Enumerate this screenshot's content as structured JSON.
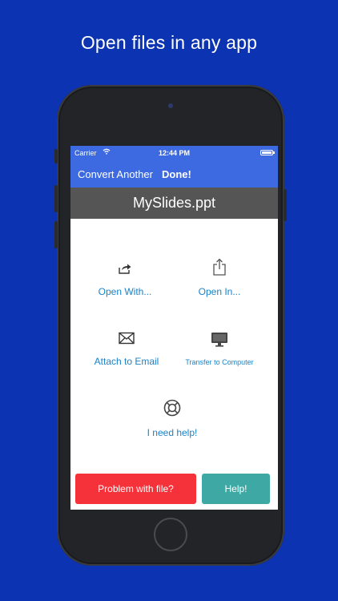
{
  "headline": "Open files in any app",
  "statusbar": {
    "carrier": "Carrier",
    "time": "12:44 PM"
  },
  "navbar": {
    "convert_another": "Convert Another",
    "done": "Done!"
  },
  "file": {
    "name": "MySlides.ppt"
  },
  "actions": {
    "open_with": {
      "label": "Open With...",
      "icon": "share-arrow-icon"
    },
    "open_in": {
      "label": "Open In...",
      "icon": "share-box-icon"
    },
    "attach_email": {
      "label": "Attach to Email",
      "icon": "envelope-icon"
    },
    "transfer_computer": {
      "label": "Transfer to Computer",
      "icon": "monitor-icon"
    },
    "need_help": {
      "label": "I need help!",
      "icon": "lifebuoy-icon"
    }
  },
  "footer": {
    "problem": "Problem with file?",
    "help": "Help!"
  },
  "colors": {
    "background": "#0c33b1",
    "navbar": "#3d6ae0",
    "filebar": "#555556",
    "link": "#1a82c9",
    "problem_button": "#f5323a",
    "help_button": "#3ea9a4"
  }
}
